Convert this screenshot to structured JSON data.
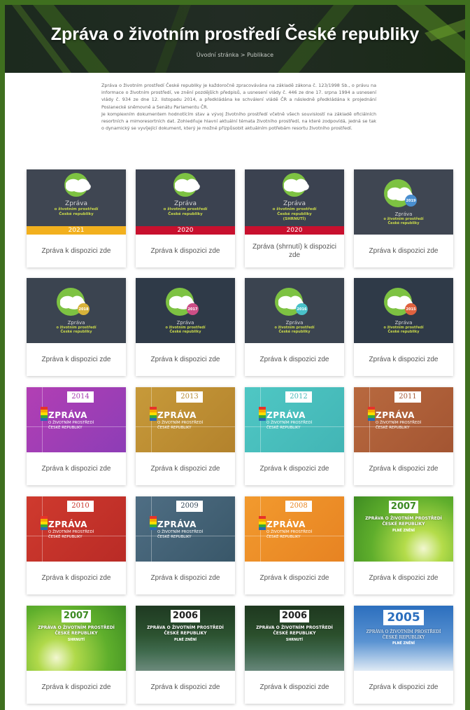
{
  "header": {
    "title": "Zpráva o životním prostředí České republiky",
    "breadcrumb": "Úvodní stránka > Publikace"
  },
  "intro": {
    "p1": "Zpráva o životním prostředí České republiky je každoročně zpracovávána na základě zákona č. 123/1998 Sb., o právu na informace o životním prostředí, ve znění pozdějších předpisů, a usnesení vlády č. 446 ze dne 17. srpna 1994 a usnesení vlády č. 934 ze dne 12. listopadu 2014, a předkládána ke schválení vládě ČR a následně předkládána k projednání Poslanecké sněmovně a Senátu Parlamentu ČR.",
    "p2": "Je komplexním dokumentem hodnotícím stav a vývoj životního prostředí včetně všech souvislostí na základě oficiálních resortních a mimoresortních dat. Zohledňuje hlavní aktuální témata životního prostředí, na které zodpovídá, jedná se tak o dynamický se vyvíjející dokument, který je možné přizpůsobit aktuálním potřebám resortu životního prostředí."
  },
  "colors": {
    "page_bg": "#3f6f1f",
    "dark_cover": "#3d4450",
    "navy_cover": "#2d3a4a",
    "red_band": "#c8102e",
    "yellow_band": "#f2b01e",
    "map_green": "#7dc242"
  },
  "cards": [
    {
      "caption": "Zpráva k dispozici zde",
      "cover": {
        "title": "Zpráva",
        "sub": "o životním prostředí\nČeské republiky",
        "band": "2021"
      }
    },
    {
      "caption": "Zpráva k dispozici zde",
      "cover": {
        "title": "Zpráva",
        "sub": "o životním prostředí\nČeské republiky",
        "band": "2020"
      }
    },
    {
      "caption": "Zpráva (shrnutí) k dispozici zde",
      "cover": {
        "title": "Zpráva",
        "sub": "o životním prostředí\nČeské republiky\n(SHRNUTÍ)",
        "band": "2020"
      }
    },
    {
      "caption": "Zpráva k dispozici zde",
      "cover": {
        "title": "Zpráva",
        "sub": "o životním prostředí\nČeské republiky",
        "badge": "2019"
      }
    },
    {
      "caption": "Zpráva k dispozici zde",
      "cover": {
        "title": "Zpráva",
        "sub": "o životním prostředí\nČeské republiky",
        "badge": "2018"
      }
    },
    {
      "caption": "Zpráva k dispozici zde",
      "cover": {
        "title": "Zpráva",
        "sub": "o životním prostředí\nČeské republiky",
        "badge": "2017"
      }
    },
    {
      "caption": "Zpráva k dispozici zde",
      "cover": {
        "title": "Zpráva",
        "sub": "o životním prostředí\nČeské republiky",
        "badge": "2016"
      }
    },
    {
      "caption": "Zpráva k dispozici zde",
      "cover": {
        "title": "Zpráva",
        "sub": "o životním prostředí\nČeské republiky",
        "badge": "2015"
      }
    },
    {
      "caption": "Zpráva k dispozici zde",
      "cover": {
        "year": "2014",
        "big": "ZPRÁVA",
        "small": "O ŽIVOTNÍM PROSTŘEDÍ\nČESKÉ REPUBLIKY"
      }
    },
    {
      "caption": "Zpráva k dispozici zde",
      "cover": {
        "year": "2013",
        "big": "ZPRÁVA",
        "small": "O ŽIVOTNÍM PROSTŘEDÍ\nČESKÉ REPUBLIKY"
      }
    },
    {
      "caption": "Zpráva k dispozici zde",
      "cover": {
        "year": "2012",
        "big": "ZPRÁVA",
        "small": "O ŽIVOTNÍM PROSTŘEDÍ\nČESKÉ REPUBLIKY"
      }
    },
    {
      "caption": "Zpráva k dispozici zde",
      "cover": {
        "year": "2011",
        "big": "ZPRÁVA",
        "small": "O ŽIVOTNÍM PROSTŘEDÍ\nČESKÉ REPUBLIKY"
      }
    },
    {
      "caption": "Zpráva k dispozici zde",
      "cover": {
        "year": "2010",
        "big": "ZPRÁVA",
        "small": "O ŽIVOTNÍM PROSTŘEDÍ\nČESKÉ REPUBLIKY"
      }
    },
    {
      "caption": "Zpráva k dispozici zde",
      "cover": {
        "year": "2009",
        "big": "ZPRÁVA",
        "small": "O ŽIVOTNÍM PROSTŘEDÍ\nČESKÉ REPUBLIKY"
      }
    },
    {
      "caption": "Zpráva k dispozici zde",
      "cover": {
        "year": "2008",
        "big": "ZPRÁVA",
        "small": "O ŽIVOTNÍM PROSTŘEDÍ\nČESKÉ REPUBLIKY"
      }
    },
    {
      "caption": "Zpráva k dispozici zde",
      "cover": {
        "year": "2007",
        "title": "ZPRÁVA O ŽIVOTNÍM PROSTŘEDÍ\nČESKÉ REPUBLIKY",
        "sub": "PLNÉ ZNĚNÍ"
      }
    },
    {
      "caption": "Zpráva k dispozici zde",
      "cover": {
        "year": "2007",
        "title": "ZPRÁVA O ŽIVOTNÍM PROSTŘEDÍ\nČESKÉ REPUBLIKY",
        "sub": "SHRNUTÍ"
      }
    },
    {
      "caption": "Zpráva k dispozici zde",
      "cover": {
        "year": "2006",
        "title": "ZPRÁVA O ŽIVOTNÍM PROSTŘEDÍ\nČESKÉ REPUBLIKY",
        "sub": "PLNÉ ZNĚNÍ"
      }
    },
    {
      "caption": "Zpráva k dispozici zde",
      "cover": {
        "year": "2006",
        "title": "ZPRÁVA O ŽIVOTNÍM PROSTŘEDÍ\nČESKÉ REPUBLIKY",
        "sub": "SHRNUTÍ"
      }
    },
    {
      "caption": "Zpráva k dispozici zde",
      "cover": {
        "year": "2005",
        "title": "ZPRÁVA O ŽIVOTNÍM PROSTŘEDÍ\nČESKÉ REPUBLIKY",
        "sub": "PLNÉ ZNĚNÍ"
      }
    }
  ]
}
